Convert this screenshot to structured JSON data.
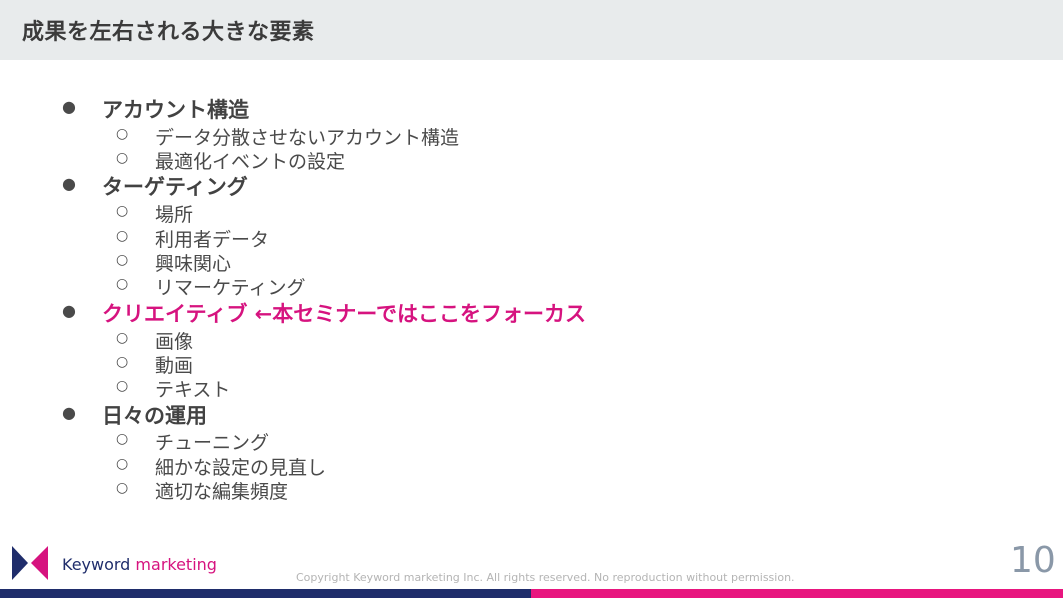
{
  "slide": {
    "title": "成果を左右される大きな要素",
    "page_number": "10",
    "copyright": "Copyright Keyword marketing Inc. All rights reserved. No reproduction without permission."
  },
  "brand": {
    "name_part1": "Keyword ",
    "name_part2": "marketing",
    "navy": "#1f2d6b",
    "magenta": "#d6137f"
  },
  "outline": {
    "bullet_l1": "●",
    "bullet_l2": "○",
    "items": [
      {
        "label": "アカウント構造",
        "children": [
          "データ分散させないアカウント構造",
          "最適化イベントの設定"
        ]
      },
      {
        "label": "ターゲティング",
        "children": [
          "場所",
          "利用者データ",
          "興味関心",
          "リマーケティング"
        ]
      },
      {
        "label": "クリエイティブ ←本セミナーではここをフォーカス",
        "highlight": true,
        "children": [
          "画像",
          "動画",
          "テキスト"
        ]
      },
      {
        "label": "日々の運用",
        "children": [
          "チューニング",
          "細かな設定の見直し",
          "適切な編集頻度"
        ]
      }
    ]
  }
}
